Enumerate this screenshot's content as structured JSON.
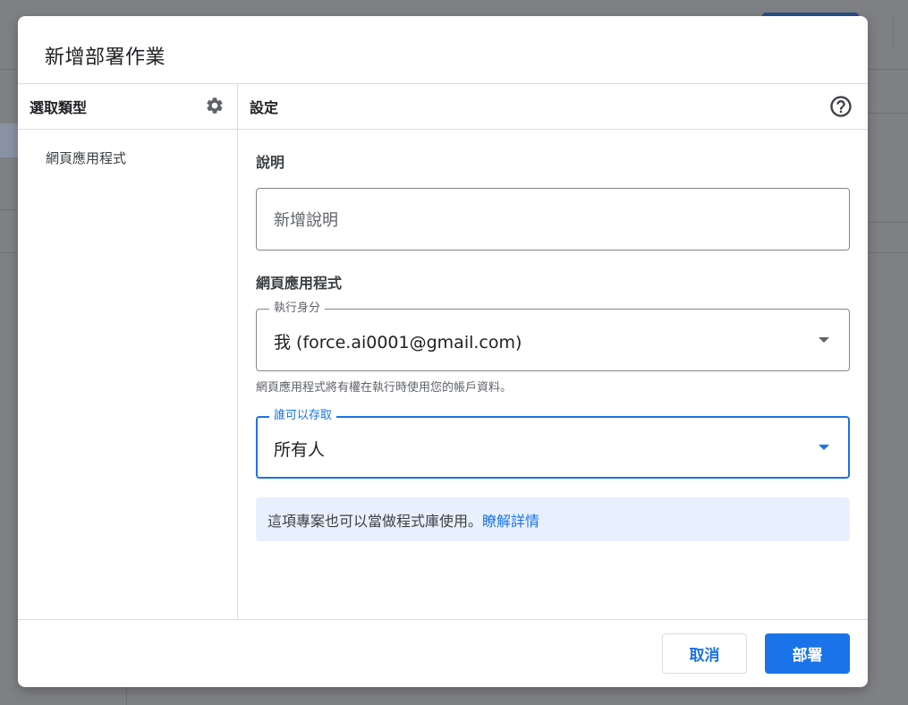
{
  "dialog": {
    "title": "新增部署作業",
    "left_panel": {
      "heading": "選取類型",
      "settings_icon": "gear-icon",
      "items": [
        {
          "label": "網頁應用程式"
        }
      ]
    },
    "right_panel": {
      "heading": "設定",
      "help_icon": "help-circle-icon",
      "description": {
        "label": "說明",
        "placeholder": "新增說明"
      },
      "web_app": {
        "section_label": "網頁應用程式",
        "execute_as": {
          "label": "執行身分",
          "value": "我 (force.ai0001@gmail.com)",
          "helper": "網頁應用程式將有權在執行時使用您的帳戶資料。"
        },
        "who_has_access": {
          "label": "誰可以存取",
          "value": "所有人"
        }
      },
      "info": {
        "text": "這項專案也可以當做程式庫使用。",
        "link": "瞭解詳情"
      }
    },
    "footer": {
      "cancel_label": "取消",
      "deploy_label": "部署"
    }
  },
  "colors": {
    "accent": "#1a73e8",
    "info_bg": "#e8f0fe",
    "overlay": "#7f8083"
  }
}
